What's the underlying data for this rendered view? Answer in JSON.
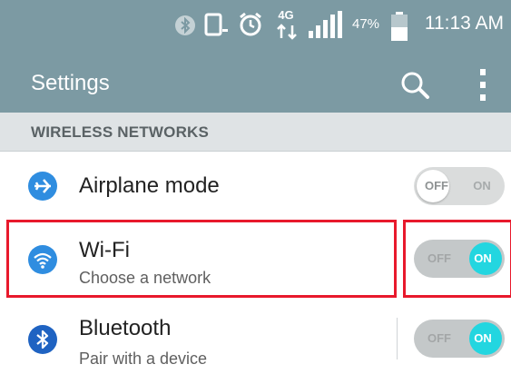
{
  "status_bar": {
    "battery_percent": "47%",
    "time": "11:13 AM",
    "network_type": "4G",
    "icons": [
      "bluetooth-icon",
      "vibrate-icon",
      "alarm-icon",
      "data-arrows-icon",
      "signal-icon",
      "battery-icon"
    ]
  },
  "app_bar": {
    "title": "Settings",
    "actions": [
      "search-icon",
      "overflow-menu-icon"
    ]
  },
  "section": {
    "label": "WIRELESS NETWORKS"
  },
  "rows": [
    {
      "title": "Airplane mode",
      "subtitle": "",
      "icon": "airplane-icon",
      "toggle": {
        "off": "OFF",
        "on": "ON",
        "state": "off"
      }
    },
    {
      "title": "Wi-Fi",
      "subtitle": "Choose a network",
      "icon": "wifi-icon",
      "toggle": {
        "off": "OFF",
        "on": "ON",
        "state": "on"
      }
    },
    {
      "title": "Bluetooth",
      "subtitle": "Pair with a device",
      "icon": "bluetooth-icon",
      "toggle": {
        "off": "OFF",
        "on": "ON",
        "state": "on"
      }
    }
  ],
  "colors": {
    "app_bar": "#7c9aa3",
    "section_bg": "#dfe3e5",
    "icon_blue": "#2f8de0",
    "toggle_on": "#23d6e0",
    "highlight": "#e8192c"
  }
}
